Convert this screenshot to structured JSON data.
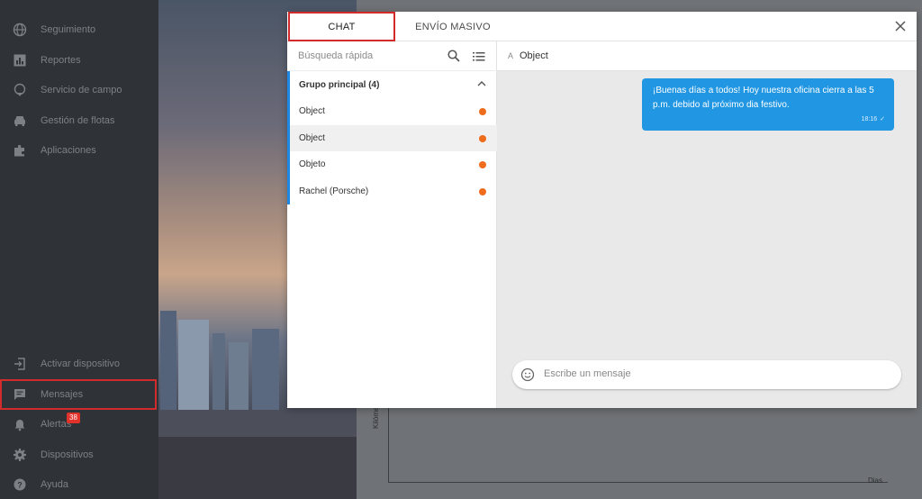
{
  "sidebar": {
    "top_items": [
      {
        "label": "Seguimiento",
        "icon": "globe-icon"
      },
      {
        "label": "Reportes",
        "icon": "bar-chart-icon"
      },
      {
        "label": "Servicio de campo",
        "icon": "location-pin-icon"
      },
      {
        "label": "Gestión de flotas",
        "icon": "car-icon"
      },
      {
        "label": "Aplicaciones",
        "icon": "puzzle-icon"
      }
    ],
    "bottom_items": [
      {
        "label": "Activar dispositivo",
        "icon": "login-icon"
      },
      {
        "label": "Mensajes",
        "icon": "chat-bubble-icon"
      },
      {
        "label": "Alertas",
        "icon": "bell-icon"
      },
      {
        "label": "Dispositivos",
        "icon": "gear-icon"
      },
      {
        "label": "Ayuda",
        "icon": "help-icon"
      }
    ],
    "alerts_badge": "38"
  },
  "modal": {
    "tabs": [
      {
        "label": "CHAT",
        "active": true
      },
      {
        "label": "ENVÍO MASIVO",
        "active": false
      }
    ],
    "close_icon": "close-icon"
  },
  "contacts": {
    "search_placeholder": "Búsqueda rápida",
    "group_label": "Grupo principal (4)",
    "items": [
      {
        "name": "Object",
        "status_color": "#ef6c1c"
      },
      {
        "name": "Object",
        "status_color": "#ef6c1c"
      },
      {
        "name": "Objeto",
        "status_color": "#ef6c1c"
      },
      {
        "name": "Rachel (Porsche)",
        "status_color": "#ef6c1c"
      }
    ]
  },
  "conversation": {
    "avatar_letter": "A",
    "title": "Object",
    "messages": [
      {
        "text": "¡Buenas días a todos! Hoy nuestra oficina cierra a las 5 p.m. debido al próximo dia festivo.",
        "time": "18:16",
        "status": "✓"
      }
    ],
    "composer_placeholder": "Escribe un mensaje"
  },
  "background_chart": {
    "xlabel": "Dias",
    "ylabel": "Kilóme"
  },
  "colors": {
    "accent": "#1e88e5",
    "bubble": "#2196e3",
    "status_dot": "#ef6c1c",
    "highlight": "#d12b2b"
  }
}
